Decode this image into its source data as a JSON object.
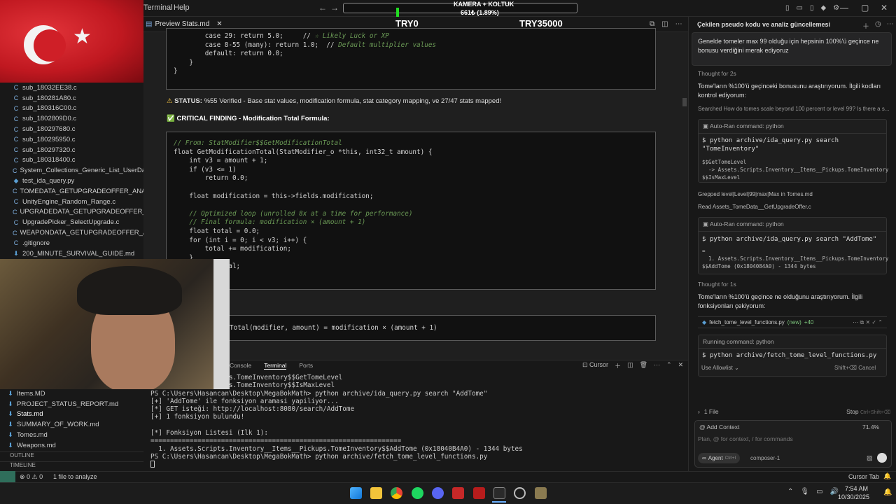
{
  "titlebar": {
    "menu_terminal": "Terminal",
    "menu_help": "Help",
    "overlay_top": "KAMERA + KOLTUK",
    "overlay_progress": "661₺ (1.89%)",
    "progress_fraction": 0.0189
  },
  "sidebar": {
    "files": [
      "sub_18032EE38.c",
      "sub_180281A80.c",
      "sub_180316C00.c",
      "sub_1802809D0.c",
      "sub_180297680.c",
      "sub_180295950.c",
      "sub_180297320.c",
      "sub_180318400.c",
      "System_Collections_Generic_List_UserDataSt...",
      "test_ida_query.py",
      "TOMEDATA_GETUPGRADEOFFER_ANALYSIS...",
      "UnityEngine_Random_Range.c",
      "UPGRADEDATA_GETUPGRADEOFFER_ANAL...",
      "UpgradePicker_SelectUpgrade.c",
      "WEAPONDATA_GETUPGRADEOFFER_ANALY...",
      ".gitignore",
      "200_MINUTE_SURVIVAL_GUIDE.md"
    ],
    "bottom_files": [
      "Items.MD",
      "PROJECT_STATUS_REPORT.md",
      "Stats.md",
      "SUMMARY_OF_WORK.md",
      "Tomes.md",
      "Weapons.md"
    ],
    "outline": "OUTLINE",
    "timeline": "TIMELINE"
  },
  "editor": {
    "tab_label": "Preview Stats.md",
    "donation_left": "TRY0",
    "donation_right": "TRY35000",
    "top_code": [
      {
        "t": "        case 29: return 5.0;     // ",
        "c": "☆ Likely Luck or XP"
      },
      {
        "t": "        case 8-55 (many): return 1.0;  // ",
        "c": "Default multiplier values"
      },
      {
        "t": "        default: return 0.0;",
        "c": ""
      },
      {
        "t": "    }",
        "c": ""
      },
      {
        "t": "}",
        "c": ""
      }
    ],
    "status_icon": "⚠",
    "status_label": "STATUS:",
    "status_text": "%55 Verified - Base stat values, modification formula, stat category mapping, ve 27/47 stats mapped!",
    "critical_icon": "✅",
    "critical_text": "CRITICAL FINDING - Modification Total Formula:",
    "code": [
      "// From: StatModifier$$GetModificationTotal",
      "float GetModificationTotal(StatModifier_o *this, int32_t amount) {",
      "    int v3 = amount + 1;",
      "    if (v3 <= 1)",
      "        return 0.0;",
      "",
      "    float modification = this->fields.modification;",
      "",
      "    // Optimized loop (unrolled 8x at a time for performance)",
      "    // Final formula: modification × (amount + 1)",
      "    float total = 0.0;",
      "    for (int i = 0; i < v3; i++) {",
      "        total += modification;",
      "    }",
      "    return total;",
      "}"
    ],
    "formula": "Total(modifier, amount) = modification × (amount + 1)"
  },
  "panel": {
    "tabs": [
      "Console",
      "Terminal",
      "Ports"
    ],
    "cursor_label": "Cursor",
    "lines": [
      "ntory__Items__Pickups.TomeInventory$$GetTomeLevel",
      "ntory__Items__Pickups.TomeInventory$$IsMaxLevel",
      "PS C:\\Users\\Hasancan\\Desktop\\MegaBokMath> python archive/ida_query.py search \"AddTome\"",
      "[+] 'AddTome' ile fonksiyon aramasi yapiliyor...",
      "[*] GET isteği: http://localhost:8080/search/AddTome",
      "[+] 1 fonksiyon bulundu!",
      "",
      "[*] Fonksiyon Listesi (Ilk 1):",
      "================================================================",
      "  1. Assets.Scripts.Inventory__Items__Pickups.TomeInventory$$AddTome (0x18040B4A0) - 1344 bytes",
      "PS C:\\Users\\Hasancan\\Desktop\\MegaBokMath> python archive/fetch_tome_level_functions.py",
      ""
    ]
  },
  "chat": {
    "header": "Çekilen pseudo kodu ve analiz güncellemesi",
    "user_msg": "Genelde tomeler max 99 olduğu için hepsinin 100%'ü geçince ne bonusu verdiğini merak ediyoruz",
    "thought1": "Thought for 2s",
    "msg1": "Tome'ların %100'ü geçinceki bonusunu araştırıyorum. İlgili kodları kontrol ediyorum:",
    "searched": "Searched How do tomes scale beyond 100 percent or level 99? Is there a s...",
    "auto1_label": "Auto-Ran command: python",
    "auto1_cmd": "$ python archive/ida_query.py search\n\"TomeInventory\"",
    "auto1_out": "$$GetTomeLevel\n  -> Assets.Scripts.Inventory__Items__Pickups.TomeInventory\n$$IsMaxLevel",
    "grepped": "Grepped level|Level|99|max|Max in Tomes.md",
    "read": "Read Assets_TomeData__GetUpgradeOffer.c",
    "auto2_label": "Auto-Ran command: python",
    "auto2_cmd": "$ python archive/ida_query.py search \"AddTome\"",
    "auto2_out": "=\n  1. Assets.Scripts.Inventory__Items__Pickups.TomeInventory\n$$AddTome (0x1804084A0) - 1344 bytes",
    "thought2": "Thought for 1s",
    "msg2": "Tome'ların %100'ü geçince ne olduğunu araştırıyorum. İlgili fonksiyonları çekiyorum:",
    "file_chip": "fetch_tome_level_functions.py",
    "file_new": "(new)",
    "file_diff": "+40",
    "running_label": "Running command: python",
    "running_cmd": "$ python archive/fetch_tome_level_functions.py",
    "allowlist": "Use Allowlist",
    "shift_hint": "Shift+⌫ Cancel",
    "one_file": "1 File",
    "stop": "Stop",
    "stop_hint": "Ctrl+Shift+⌫",
    "add_context": "@ Add Context",
    "context_pct": "71.4%",
    "input_placeholder": "Plan, @ for context, / for commands",
    "agent": "Agent",
    "agent_hint": "Ctrl+I",
    "model": "composer-1"
  },
  "statusbar": {
    "problems": "⊗ 0 ⚠ 0",
    "analyze": "1 file to analyze",
    "cursor_tab": "Cursor Tab"
  },
  "taskbar": {
    "time": "7:54 AM",
    "date": "10/30/2025"
  }
}
